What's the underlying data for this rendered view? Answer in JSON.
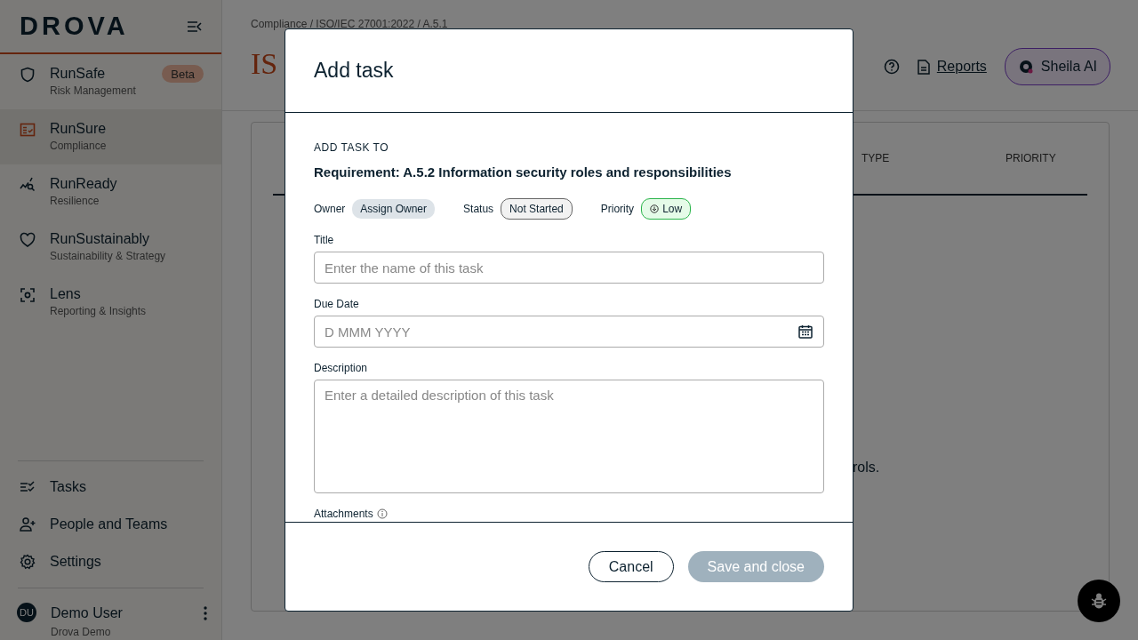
{
  "sidebar": {
    "logo": "DROVA",
    "modules": [
      {
        "title": "RunSafe",
        "subtitle": "Risk Management",
        "badge": "Beta",
        "selected": false,
        "kind": "shield"
      },
      {
        "title": "RunSure",
        "subtitle": "Compliance",
        "selected": true,
        "kind": "checklist"
      },
      {
        "title": "RunReady",
        "subtitle": "Resilience",
        "selected": false,
        "kind": "chart"
      },
      {
        "title": "RunSustainably",
        "subtitle": "Sustainability & Strategy",
        "selected": false,
        "kind": "heart"
      },
      {
        "title": "Lens",
        "subtitle": "Reporting & Insights",
        "selected": false,
        "kind": "lens"
      }
    ],
    "nav": [
      {
        "label": "Tasks",
        "kind": "tasks"
      },
      {
        "label": "People and Teams",
        "kind": "people"
      },
      {
        "label": "Settings",
        "kind": "settings"
      }
    ],
    "user": {
      "initials": "DU",
      "name": "Demo User",
      "org": "Drova Demo"
    }
  },
  "page": {
    "breadcrumb": "Compliance / ISO/IEC 27001:2022 / A.5.1",
    "title": "IS",
    "reports": "Reports",
    "assistant": "Sheila AI",
    "table": {
      "columns": [
        "TYPE",
        "PRIORITY"
      ]
    },
    "empty_text": "rols."
  },
  "modal": {
    "title": "Add task",
    "context_label": "ADD TASK TO",
    "context": "Requirement: A.5.2 Information security roles and responsibilities",
    "meta": [
      {
        "label": "Owner",
        "value": "Assign Owner",
        "kind": "owner"
      },
      {
        "label": "Status",
        "value": "Not Started",
        "kind": "status"
      },
      {
        "label": "Priority",
        "value": "Low",
        "kind": "priority"
      }
    ],
    "fields": [
      {
        "label": "Title",
        "placeholder": "Enter the name of this task",
        "kind": "text"
      },
      {
        "label": "Due Date",
        "placeholder": "D MMM YYYY",
        "kind": "date"
      },
      {
        "label": "Description",
        "placeholder": "Enter a detailed description of this task",
        "kind": "textarea"
      }
    ],
    "attachments_label": "Attachments",
    "buttons": [
      {
        "label": "Cancel",
        "kind": "secondary",
        "disabled": false
      },
      {
        "label": "Save and close",
        "kind": "primary",
        "disabled": true
      }
    ]
  }
}
